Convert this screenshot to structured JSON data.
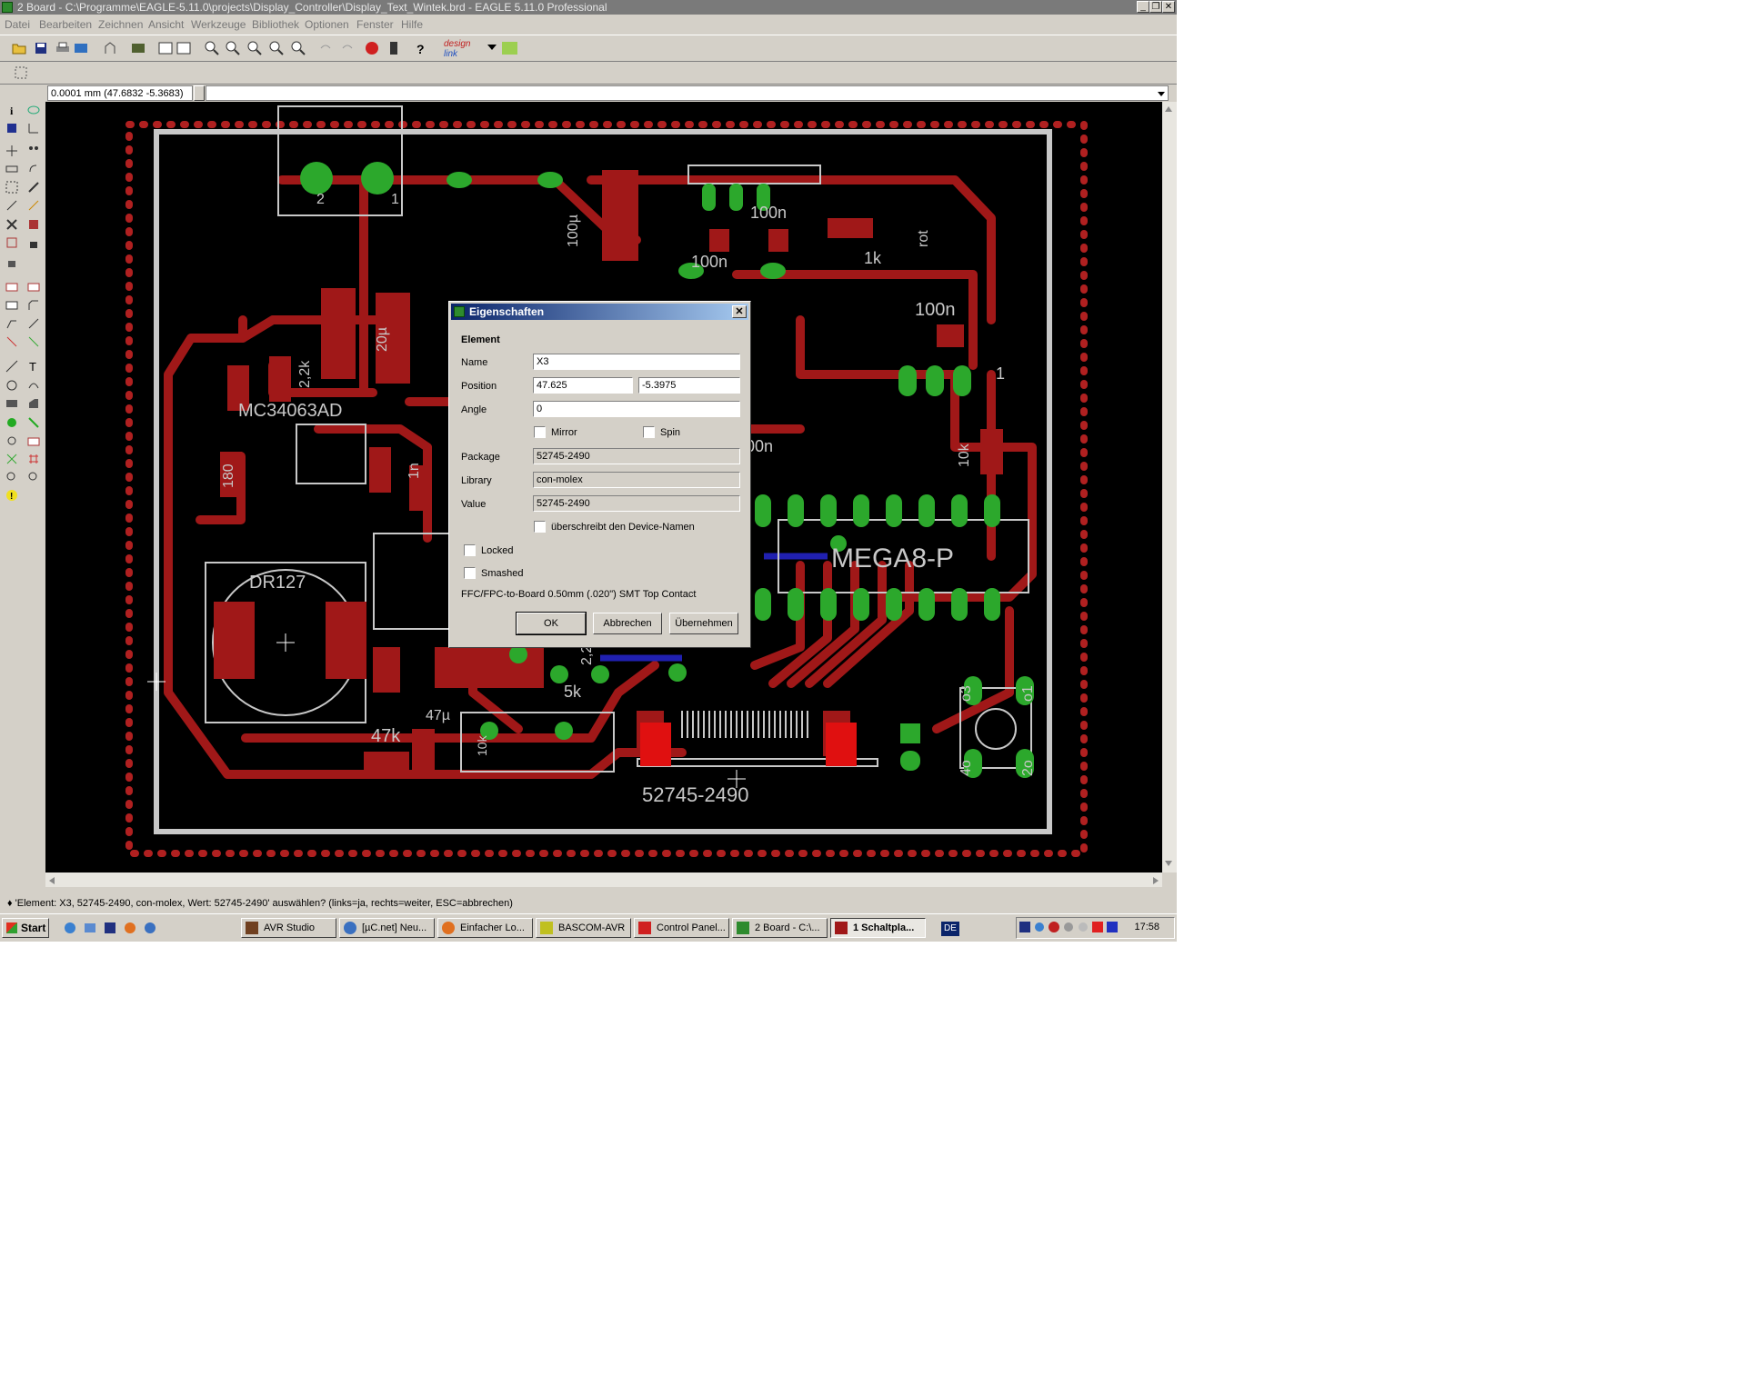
{
  "window": {
    "title": "2 Board - C:\\Programme\\EAGLE-5.11.0\\projects\\Display_Controller\\Display_Text_Wintek.brd - EAGLE 5.11.0 Professional",
    "controls": [
      "_",
      "❐",
      "✕"
    ]
  },
  "menu": [
    "Datei",
    "Bearbeiten",
    "Zeichnen",
    "Ansicht",
    "Werkzeuge",
    "Bibliothek",
    "Optionen",
    "Fenster",
    "Hilfe"
  ],
  "toolbar": {
    "icons": [
      "open-icon",
      "save-icon",
      "print-icon",
      "cam-icon",
      "board-schematic-icon",
      "script-icon",
      "ulp-icon",
      "zoom-fit-icon",
      "zoom-in-icon",
      "zoom-out-icon",
      "redraw-icon",
      "zoom-select-icon",
      "undo-icon",
      "redo-icon",
      "stop-icon",
      "go-icon",
      "help-icon"
    ],
    "logo_design": "design",
    "logo_link": "link"
  },
  "coordinate_display": "0.0001 mm (47.6832 -5.3683)",
  "board": {
    "labels": {
      "dr127": "DR127",
      "mc34063": "MC34063AD",
      "mega8": "MEGA8-P",
      "x3": "52745-2490",
      "r47k": "47k",
      "c100u": "100µ",
      "c20u": "20µ",
      "r2k2": "2,2k",
      "r180": "180",
      "c1n": "1n",
      "c47u": "47µ",
      "r5k": "5k",
      "c100n_a": "100n",
      "c100n_b": "100n",
      "c100n_c": "100n",
      "r1k": "1k",
      "rot": "rot",
      "r10k": "10k",
      "c100n_d": "00n",
      "pin1": "1",
      "pin2": "2",
      "pin1b": "1",
      "sw_a": "o3",
      "sw_b": "o1",
      "sw_c": "4o",
      "sw_d": "2o",
      "r22": "2,2",
      "r10k_b": "10k"
    }
  },
  "dialog": {
    "title": "Eigenschaften",
    "section": "Element",
    "name_label": "Name",
    "name_value": "X3",
    "position_label": "Position",
    "position_x": "47.625",
    "position_y": "-5.3975",
    "angle_label": "Angle",
    "angle_value": "0",
    "mirror_label": "Mirror",
    "spin_label": "Spin",
    "package_label": "Package",
    "package_value": "52745-2490",
    "library_label": "Library",
    "library_value": "con-molex",
    "value_label": "Value",
    "value_value": "52745-2490",
    "override_label": "überschreibt den Device-Namen",
    "locked_label": "Locked",
    "smashed_label": "Smashed",
    "description": "FFC/FPC-to-Board  0.50mm (.020\") SMT Top Contact",
    "ok_label": "OK",
    "cancel_label": "Abbrechen",
    "apply_label": "Übernehmen"
  },
  "status_text": "♦ 'Element: X3, 52745-2490, con-molex, Wert: 52745-2490' auswählen? (links=ja, rechts=weiter, ESC=abbrechen)",
  "taskbar": {
    "start_label": "Start",
    "tasks": [
      {
        "label": "AVR Studio",
        "active": false
      },
      {
        "label": "[µC.net] Neu...",
        "active": false
      },
      {
        "label": "Einfacher Lo...",
        "active": false
      },
      {
        "label": "BASCOM-AVR",
        "active": false
      },
      {
        "label": "Control Panel...",
        "active": false
      },
      {
        "label": "2 Board - C:\\...",
        "active": false
      },
      {
        "label": "1 Schaltpla...",
        "active": true
      }
    ],
    "language": "DE",
    "clock": "17:58"
  },
  "colors": {
    "board_bg": "#000000",
    "trace": "#a01818",
    "pad": "#2ca82c",
    "via_dot": "#b02020",
    "outline": "#c8c8c8",
    "bottom_trace": "#2020b0",
    "title_active": "#0a246a"
  }
}
